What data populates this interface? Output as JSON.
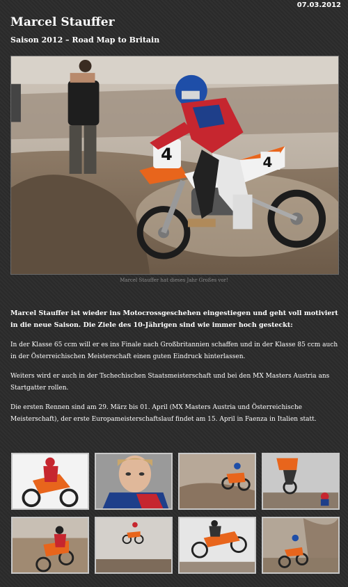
{
  "header": {
    "date": "07.03.2012",
    "title": "Marcel Stauffer",
    "subtitle": "Saison 2012 – Road Map to Britain"
  },
  "hero": {
    "caption": "Marcel Stauffer hat dieses Jahr Großes vor!",
    "bike_number": "4"
  },
  "article": {
    "intro": "Marcel Stauffer ist wieder ins Motocrossgeschehen eingestiegen und geht voll motiviert in die neue Saison. Die Ziele des 10-Jährigen sind wie immer  hoch gesteckt:",
    "paragraphs": [
      "In der Klasse 65 ccm will er es ins Finale nach Großbritannien schaffen und in der Klasse 85 ccm auch in der Österreichischen Meisterschaft einen guten Eindruck hinterlassen.",
      "Weiters wird er auch in der Tschechischen Staatsmeisterschaft und bei den MX Masters Austria ans Startgatter rollen.",
      "Die ersten Rennen sind am 29. März bis 01. April (MX Masters Austria und Österreichische Meisterschaft), der erste Europameisterschaftslauf findet am 15. April in Faenza in Italien statt."
    ]
  },
  "gallery": {
    "thumbnails": [
      {
        "subject": "rider on orange bike, white background"
      },
      {
        "subject": "portrait of young rider"
      },
      {
        "subject": "rider jumping over dirt"
      },
      {
        "subject": "rider mid-air, second rider behind"
      },
      {
        "subject": "rider cornering in dust"
      },
      {
        "subject": "rider jumping, grey sky"
      },
      {
        "subject": "rider whipping bike in air"
      },
      {
        "subject": "rider throwing up dust"
      }
    ]
  },
  "colors": {
    "background": "#2b2b2b",
    "bike_orange": "#e8651c",
    "caption_grey": "#8a8a8a"
  }
}
